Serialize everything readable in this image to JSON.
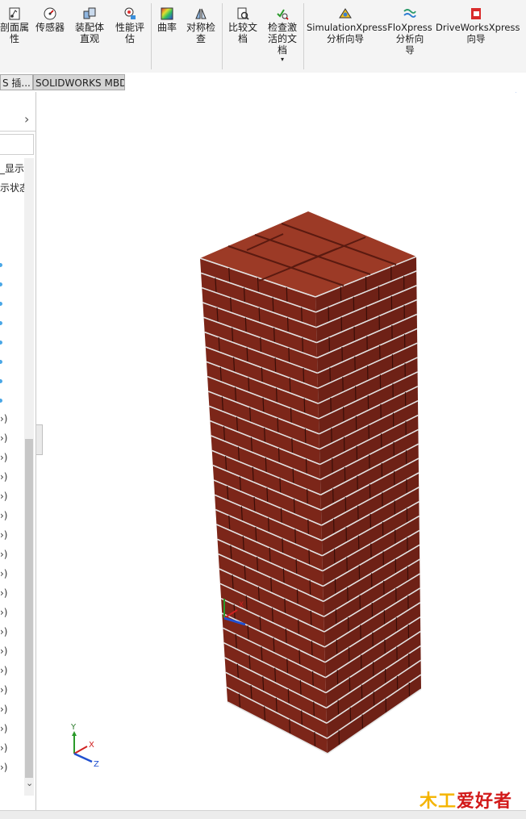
{
  "ribbon": {
    "buttons": [
      {
        "id": "section",
        "label": "剖面属\n性",
        "icon": "section-properties-icon"
      },
      {
        "id": "sensor",
        "label": "传感器",
        "icon": "sensor-icon"
      },
      {
        "id": "assembly",
        "label": "装配体\n直观",
        "icon": "assembly-visualization-icon"
      },
      {
        "id": "perf",
        "label": "性能评\n估",
        "icon": "performance-evaluation-icon"
      },
      {
        "id": "curvature",
        "label": "曲率",
        "icon": "curvature-icon"
      },
      {
        "id": "symmetry",
        "label": "对称检\n查",
        "icon": "symmetry-check-icon"
      },
      {
        "id": "compare",
        "label": "比较文\n档",
        "icon": "compare-documents-icon"
      },
      {
        "id": "checkactive",
        "label": "检查激\n活的文\n档",
        "icon": "check-active-document-icon"
      },
      {
        "id": "simxpress",
        "label": "SimulationXpress\n分析向导",
        "icon": "simulationxpress-icon"
      },
      {
        "id": "floxpress",
        "label": "FloXpress\n分析向\n导",
        "icon": "floxpress-icon"
      },
      {
        "id": "driveworks",
        "label": "DriveWorksXpress\n向导",
        "icon": "driveworksxpress-icon"
      }
    ],
    "dropdown_arrow": "▾"
  },
  "tabs": [
    {
      "label": "S 插...",
      "active": false
    },
    {
      "label": "SOLIDWORKS MBD",
      "active": true
    }
  ],
  "left_panel": {
    "expand_glyph": "›",
    "rows": [
      {
        "label": "_显示"
      },
      {
        "label": "示状态"
      }
    ],
    "tree_suffix": "›)",
    "scroll_up": "⌃",
    "scroll_down": "⌄"
  },
  "viewport": {
    "search_icon": "search-icon",
    "triad_labels": {
      "x": "X",
      "y": "Y",
      "z": "Z"
    }
  },
  "watermark": {
    "part1": "木工",
    "part2": "爱好者"
  },
  "colors": {
    "brick": "#7a2418",
    "brick_top": "#9a3a26",
    "mortar": "#d9d9d9",
    "accent": "#2060c0"
  }
}
